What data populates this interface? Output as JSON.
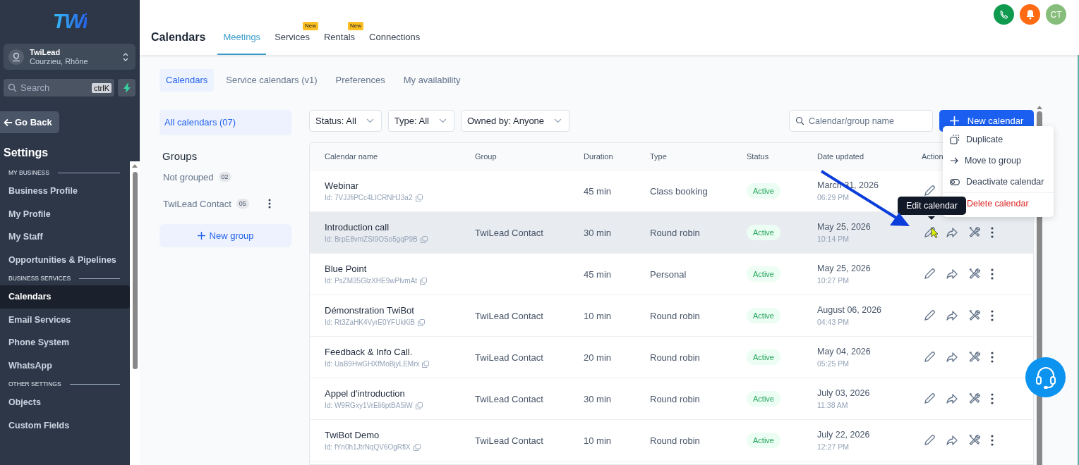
{
  "sidebar": {
    "logo": "TWi",
    "account": {
      "name": "TwiLead",
      "location": "Courzieu, Rhône"
    },
    "search": {
      "placeholder": "Search",
      "shortcut": "ctrlK"
    },
    "back": "Go Back",
    "title": "Settings",
    "sections": [
      {
        "label": "MY BUSINESS",
        "items": [
          {
            "label": "Business Profile",
            "selected": false
          },
          {
            "label": "My Profile",
            "selected": false
          },
          {
            "label": "My Staff",
            "selected": false
          },
          {
            "label": "Opportunities & Pipelines",
            "selected": false
          }
        ]
      },
      {
        "label": "BUSINESS SERVICES",
        "items": [
          {
            "label": "Calendars",
            "selected": true
          },
          {
            "label": "Email Services",
            "selected": false
          },
          {
            "label": "Phone System",
            "selected": false
          },
          {
            "label": "WhatsApp",
            "selected": false
          }
        ]
      },
      {
        "label": "OTHER SETTINGS",
        "items": [
          {
            "label": "Objects",
            "selected": false
          },
          {
            "label": "Custom Fields",
            "selected": false
          }
        ]
      }
    ]
  },
  "header": {
    "title": "Calendars",
    "tabs": [
      {
        "label": "Meetings",
        "selected": true
      },
      {
        "label": "Services",
        "selected": false,
        "badge": "New"
      },
      {
        "label": "Rentals",
        "selected": false,
        "badge": "New"
      },
      {
        "label": "Connections",
        "selected": false
      }
    ],
    "avatar": "CT"
  },
  "subtabs": [
    {
      "label": "Calendars",
      "selected": true
    },
    {
      "label": "Service calendars (v1)",
      "selected": false
    },
    {
      "label": "Preferences",
      "selected": false
    },
    {
      "label": "My availability",
      "selected": false
    }
  ],
  "left_panel": {
    "all": {
      "label": "All calendars (07)",
      "selected": true
    },
    "groups_title": "Groups",
    "groups": [
      {
        "name": "Not grouped",
        "count": "02",
        "menu": false
      },
      {
        "name": "TwiLead Contact",
        "count": "05",
        "menu": true
      }
    ],
    "new_group": "New group"
  },
  "filters": [
    "Status: All",
    "Type: All",
    "Owned by: Anyone"
  ],
  "search": {
    "placeholder": "Calendar/group name"
  },
  "new_button": "New calendar",
  "table": {
    "columns": [
      "Calendar name",
      "Group",
      "Duration",
      "Type",
      "Status",
      "Date updated",
      "Action"
    ],
    "rows": [
      {
        "name": "Webinar",
        "id": "Id: 7VJJfiPCc4LICRNHJ3a2",
        "duration": "45 min",
        "type": "Class booking",
        "status": "Active",
        "date": "March 31, 2026",
        "time": "06:29 PM",
        "hovered": false,
        "actions": [
          {
            "kind": "edit"
          }
        ]
      },
      {
        "name": "Introduction call",
        "id": "Id: BrpE8vmZSI9OSo5gqP9B",
        "group": "TwiLead Contact",
        "duration": "30 min",
        "type": "Round robin",
        "status": "Active",
        "date": "May 25, 2026",
        "time": "10:14 PM",
        "hovered": true,
        "actions": [
          {
            "kind": "edit"
          },
          {
            "kind": "share"
          },
          {
            "kind": "tools"
          },
          {
            "kind": "more"
          }
        ]
      },
      {
        "name": "Blue Point",
        "id": "Id: PsZM35GlzXHE9wPlvmAt",
        "duration": "45 min",
        "type": "Personal",
        "status": "Active",
        "date": "May 25, 2026",
        "time": "10:27 PM",
        "hovered": false,
        "actions": [
          {
            "kind": "edit"
          },
          {
            "kind": "share"
          },
          {
            "kind": "tools"
          },
          {
            "kind": "more"
          }
        ]
      },
      {
        "name": "Démonstration TwiBot",
        "id": "Id: Rt3ZaHK4VyrE0YFUkKiB",
        "group": "TwiLead Contact",
        "duration": "10 min",
        "type": "Round robin",
        "status": "Active",
        "date": "August 06, 2026",
        "time": "04:43 PM",
        "hovered": false,
        "actions": [
          {
            "kind": "edit"
          },
          {
            "kind": "share"
          },
          {
            "kind": "tools"
          },
          {
            "kind": "more"
          }
        ]
      },
      {
        "name": "Feedback & Info Call.",
        "id": "Id: UaB9HwGHXfMoBjyLEMrx",
        "group": "TwiLead Contact",
        "duration": "20 min",
        "type": "Round robin",
        "status": "Active",
        "date": "May 04, 2026",
        "time": "05:25 PM",
        "hovered": false,
        "actions": [
          {
            "kind": "edit"
          },
          {
            "kind": "share"
          },
          {
            "kind": "tools"
          },
          {
            "kind": "more"
          }
        ]
      },
      {
        "name": "Appel d'introduction",
        "id": "Id: W9RGxy1VrEli6ptBA5iW",
        "group": "TwiLead Contact",
        "duration": "30 min",
        "type": "Round robin",
        "status": "Active",
        "date": "July 03, 2026",
        "time": "11:38 AM",
        "hovered": false,
        "actions": [
          {
            "kind": "edit"
          },
          {
            "kind": "share"
          },
          {
            "kind": "tools"
          },
          {
            "kind": "more"
          }
        ]
      },
      {
        "name": "TwiBot Demo",
        "id": "Id: fYn0h1JtrNqQV6OgRflX",
        "group": "TwiLead Contact",
        "duration": "10 min",
        "type": "Round robin",
        "status": "Active",
        "date": "July 22, 2026",
        "time": "12:27 PM",
        "hovered": false,
        "actions": [
          {
            "kind": "edit"
          },
          {
            "kind": "share"
          },
          {
            "kind": "tools"
          },
          {
            "kind": "more"
          }
        ]
      }
    ]
  },
  "menu": [
    {
      "label": "Duplicate",
      "kind": "duplicate"
    },
    {
      "label": "Move to group",
      "kind": "move"
    },
    {
      "label": "Deactivate calendar",
      "kind": "deactivate"
    },
    {
      "label": "Delete calendar",
      "kind": "delete"
    }
  ],
  "tooltip": "Edit calendar"
}
